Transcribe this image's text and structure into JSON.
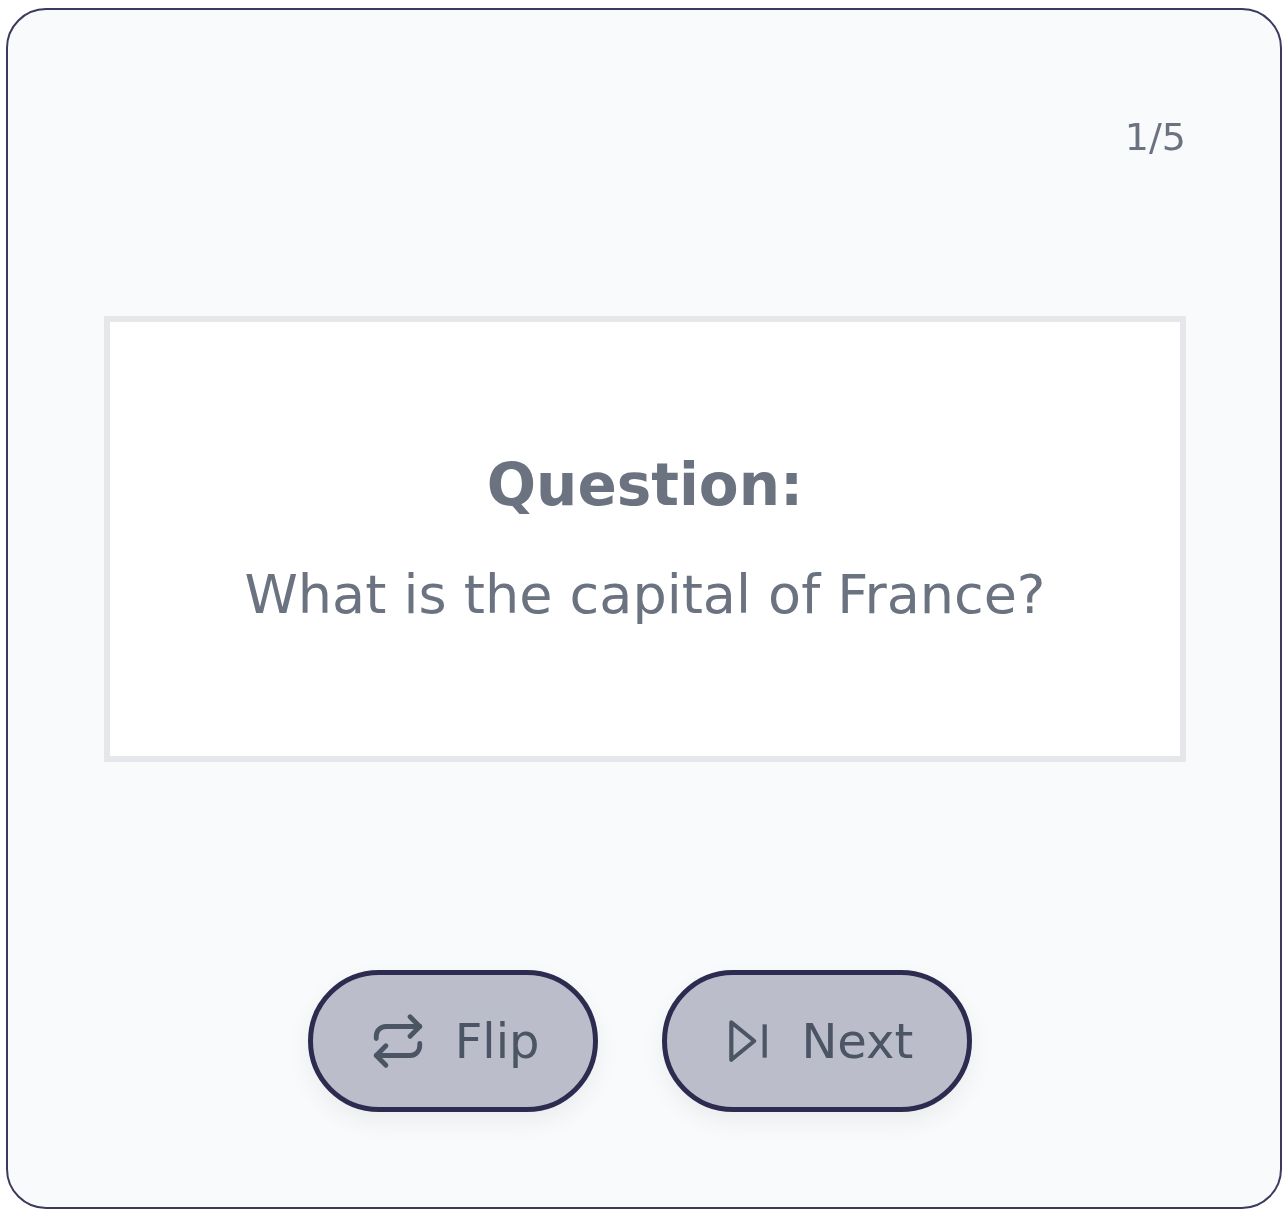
{
  "counter": "1/5",
  "card": {
    "heading": "Question:",
    "text": "What is the capital of France?"
  },
  "buttons": [
    {
      "kind": "flip",
      "label": "Flip"
    },
    {
      "kind": "next",
      "label": "Next"
    }
  ]
}
